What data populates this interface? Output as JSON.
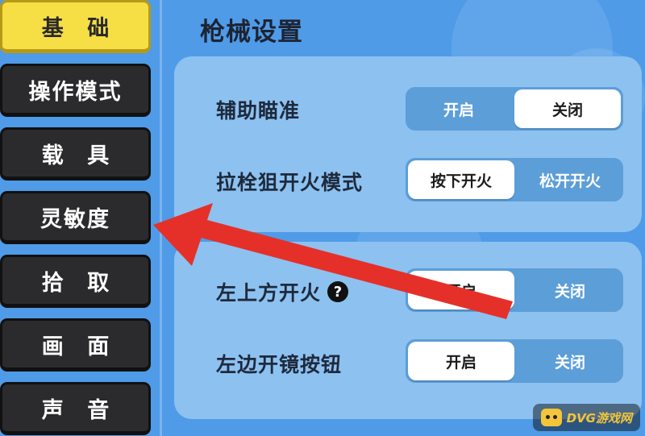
{
  "sidebar": {
    "items": [
      {
        "label": "基 础",
        "active": true
      },
      {
        "label": "操作模式",
        "active": false
      },
      {
        "label": "载 具",
        "active": false
      },
      {
        "label": "灵敏度",
        "active": false
      },
      {
        "label": "拾 取",
        "active": false
      },
      {
        "label": "画 面",
        "active": false
      },
      {
        "label": "声 音",
        "active": false
      }
    ]
  },
  "main": {
    "title": "枪械设置",
    "settings": [
      {
        "label": "辅助瞄准",
        "options": [
          "开启",
          "关闭"
        ],
        "selected": "关闭"
      },
      {
        "label": "拉栓狙开火模式",
        "options": [
          "按下开火",
          "松开开火"
        ],
        "selected": "按下开火"
      },
      {
        "label": "左上方开火",
        "help": "?",
        "options": [
          "开启",
          "关闭"
        ],
        "selected": "开启"
      },
      {
        "label": "左边开镜按钮",
        "options": [
          "开启",
          "关闭"
        ],
        "selected": "开启"
      }
    ]
  },
  "overlay": {
    "arrow_color": "#e5302a",
    "arrow_points_to": "灵敏度"
  },
  "watermark": {
    "text": "DVG游戏网",
    "icon": "gamepad-icon"
  },
  "colors": {
    "background": "#4f9be8",
    "active_tab": "#f6de45",
    "tab": "#2b2b2d",
    "panel": "#8dc1f0"
  }
}
